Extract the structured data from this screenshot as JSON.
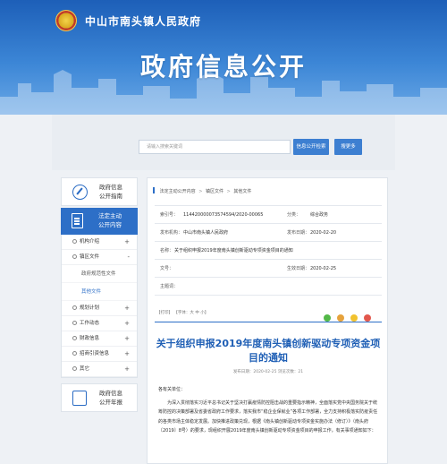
{
  "header": {
    "site_name": "中山市南头镇人民政府",
    "page_heading": "政府信息公开"
  },
  "search": {
    "placeholder": "请输入搜索关键词",
    "search_button": "信息公开检索",
    "more_button": "搜更多"
  },
  "sidebar": {
    "guide": "政府信息\n公开指南",
    "active": "法定主动\n公开内容",
    "items": [
      {
        "label": "机构介绍",
        "expand": "+"
      },
      {
        "label": "镇区文件",
        "expand": "-"
      },
      {
        "label": "规划计划",
        "expand": "+"
      },
      {
        "label": "工作动态",
        "expand": "+"
      },
      {
        "label": "财政信息",
        "expand": "+"
      },
      {
        "label": "招商引资信息",
        "expand": "+"
      },
      {
        "label": "其它",
        "expand": "+"
      }
    ],
    "sub_items": [
      "政府规范性文件",
      "其他文件"
    ],
    "annual_report": "政府信息\n公开年报"
  },
  "breadcrumb": [
    "法定主动公开内容",
    "镇区文件",
    "其他文件"
  ],
  "meta": {
    "index_label": "索引号：",
    "index_value": "11442000007357459​4/2020-00065",
    "category_label": "分类：",
    "category_value": "综合政务",
    "publisher_label": "发布机构：",
    "publisher_value": "中山市南头镇人民政府",
    "date_label": "发布日期：",
    "date_value": "2020-02-20",
    "name_label": "名称：",
    "name_value": "关于组织申报2019年度南头镇创新驱动专项资金项目的通知",
    "doc_no_label": "文号：",
    "doc_no_value": "",
    "effective_label": "生效日期：",
    "effective_value": "2020-02-25",
    "subject_label": "主题词：",
    "subject_value": ""
  },
  "tools": "【打印】 【字体：大 中 小】",
  "article": {
    "title": "关于组织申报2019年度南头镇创新驱动专项资金项目的通知",
    "date_line": "发布日期：2020-02-25    浏览次数：21",
    "greeting": "各有关单位：",
    "body": "为深入贯彻落实习近平总书记关于坚决打赢疫情防控阻击战的重要指示精神，全面落实党中央国务院关于统筹防控的决策部署及省委省政府工作要求，落实我市“稳企业保就业”各项工作部署，全力支持积极落实防疫责任的各类市场主体稳定发展。加快推进政策兑现，根据《南头镇创新驱动专项资金实施办法（修订）》（南头府〔2019〕8号）的要求，现组织开展2019年度南头镇创新驱动专项资金项目的申报工作，有关事项通知如下："
  },
  "colors": {
    "brand_blue": "#2d6fc7",
    "title_blue": "#1f5fb5"
  }
}
